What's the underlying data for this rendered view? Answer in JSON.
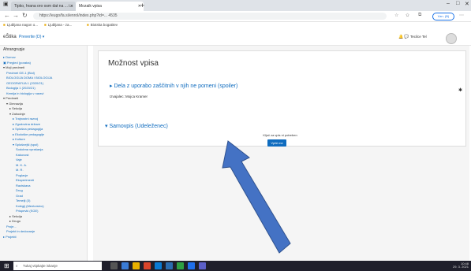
{
  "browser": {
    "tabs": [
      {
        "label": "Tipko, hrana oro osm dat na ... i..."
      },
      {
        "label": "Mozaik vpisa"
      }
    ],
    "new_tab": "+",
    "address": "https://eugo/fa.si/enrol/index.php?id=... 4535",
    "sync_label": "Vzn. (B)",
    "bookmarks": [
      "Ljubljana nagon o...",
      "Ljubljana - za...",
      "Biotska bogatitev"
    ]
  },
  "header": {
    "site_name": "eŠtika",
    "site_menu": "Preverite (D) ▾",
    "user": "Tecilce Tel"
  },
  "sidebar": {
    "title": "Ahrangrupje",
    "items": [
      {
        "label": "▸ Domov",
        "indent": 0,
        "type": "link"
      },
      {
        "label": "▣ Pregled (poraba)",
        "indent": 0,
        "type": "link"
      },
      {
        "label": "▾ Moji predmeti",
        "indent": 0,
        "type": "head"
      },
      {
        "label": "Predmet GE-1 (Biol)",
        "indent": 1,
        "type": "link"
      },
      {
        "label": "BIOLOGIJA DOMA / BIOLOGIJA",
        "indent": 1,
        "type": "link"
      },
      {
        "label": "GEOGRAFIJA 1 (2020/21)",
        "indent": 1,
        "type": "link"
      },
      {
        "label": "Biologija 1 (2020/21)",
        "indent": 1,
        "type": "link"
      },
      {
        "label": "Kemija in biologija v naravi",
        "indent": 1,
        "type": "link"
      },
      {
        "label": "▾ Predmeti",
        "indent": 0,
        "type": "plain"
      },
      {
        "label": "▾ Gimnazija",
        "indent": 1,
        "type": "plain"
      },
      {
        "label": "▸ Sekcija",
        "indent": 2,
        "type": "plain"
      },
      {
        "label": "▾ Zahodnje",
        "indent": 2,
        "type": "plain"
      },
      {
        "label": "▸ Trajnostni razvoj",
        "indent": 3,
        "type": "link"
      },
      {
        "label": "▸ Zgodovina države",
        "indent": 3,
        "type": "link"
      },
      {
        "label": "▸ Splošna pedagogija",
        "indent": 3,
        "type": "link"
      },
      {
        "label": "▸ Ekološke pedagogije",
        "indent": 3,
        "type": "link"
      },
      {
        "label": "▸ Kulture",
        "indent": 3,
        "type": "link"
      },
      {
        "label": "▾ Splošnejši (spol)",
        "indent": 3,
        "type": "link"
      },
      {
        "label": "Sodobna vprašanja",
        "indent": 4,
        "type": "link"
      },
      {
        "label": "Kakovost",
        "indent": 4,
        "type": "link"
      },
      {
        "label": "Vaje",
        "indent": 4,
        "type": "link"
      },
      {
        "label": "M. K. A.",
        "indent": 4,
        "type": "link"
      },
      {
        "label": "M. R.",
        "indent": 4,
        "type": "link"
      },
      {
        "label": "Poglavje",
        "indent": 4,
        "type": "link"
      },
      {
        "label": "Eksperimenti",
        "indent": 4,
        "type": "link"
      },
      {
        "label": "Raziskava",
        "indent": 4,
        "type": "link"
      },
      {
        "label": "Drug",
        "indent": 4,
        "type": "link"
      },
      {
        "label": "Grad",
        "indent": 4,
        "type": "link"
      },
      {
        "label": "Temelji (3)",
        "indent": 4,
        "type": "link"
      },
      {
        "label": "Kolegij (Mentorstvo)",
        "indent": 4,
        "type": "link"
      },
      {
        "label": "Prispevki (SGE)",
        "indent": 4,
        "type": "link"
      },
      {
        "label": "▸ Sekcija",
        "indent": 2,
        "type": "plain"
      },
      {
        "label": "▸ Drugo",
        "indent": 2,
        "type": "plain"
      },
      {
        "label": "Proje...",
        "indent": 1,
        "type": "link"
      },
      {
        "label": "Projekt in dedovanje",
        "indent": 1,
        "type": "link"
      },
      {
        "label": "▸ Projekti",
        "indent": 0,
        "type": "link"
      }
    ]
  },
  "main": {
    "page_title": "Možnost vpisa",
    "enrol_option_1": "Dela z uporabo zaščitnih v njih ne pomeni (spoiler)",
    "teacher": "Izvajalec: Mojca Kramer",
    "enrol_option_2": "Samovpis (Udeleženec)",
    "no_key": "Ključ za vpis ni potreben",
    "enrol_button": "Vpiši me"
  },
  "taskbar": {
    "search_placeholder": "Tukaj vtipkajte iskanje",
    "clock_time": "10:48",
    "clock_date": "29. 3. 2021"
  },
  "colors": {
    "link": "#0f6cbf",
    "arrow_fill": "#4472c4",
    "arrow_stroke": "#2f528f"
  }
}
